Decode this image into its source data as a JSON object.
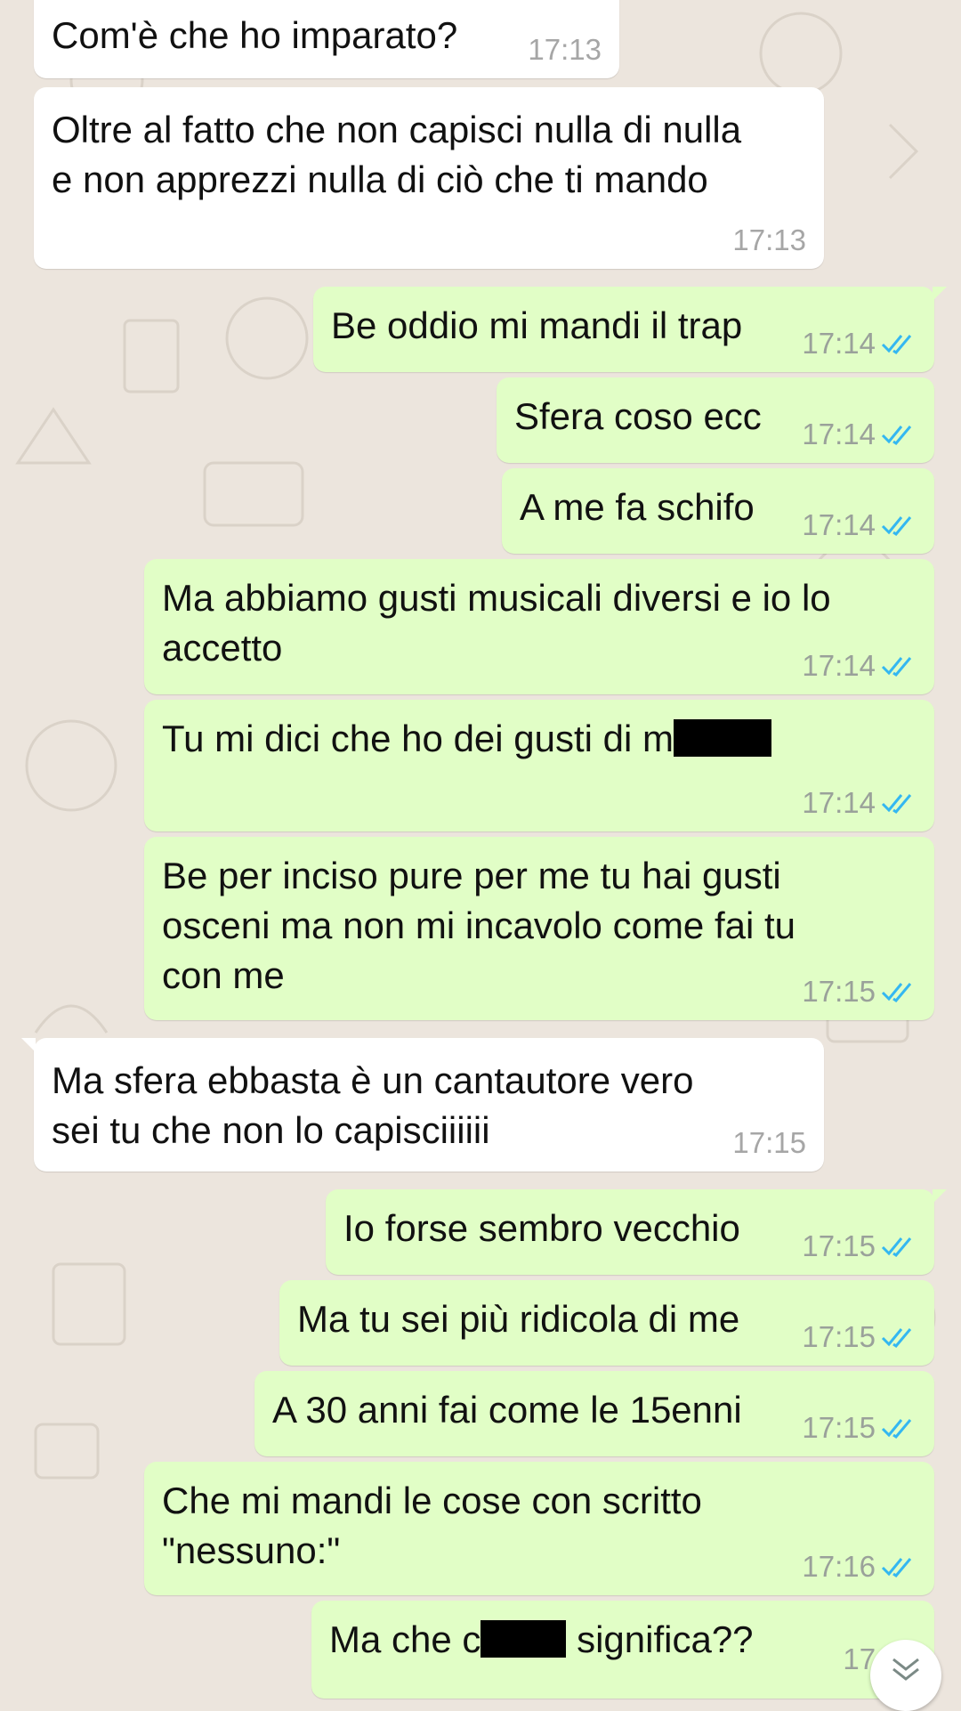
{
  "messages": [
    {
      "dir": "in",
      "text": "Com'è che ho imparato?",
      "time": "17:13"
    },
    {
      "dir": "in",
      "text": "Oltre al fatto che non capisci nulla di nulla\ne non apprezzi nulla di ciò che ti mando",
      "time": "17:13"
    },
    {
      "dir": "out",
      "text": "Be oddio mi mandi il trap",
      "time": "17:14"
    },
    {
      "dir": "out",
      "text": "Sfera coso ecc",
      "time": "17:14"
    },
    {
      "dir": "out",
      "text": "A me fa schifo",
      "time": "17:14"
    },
    {
      "dir": "out",
      "text": "Ma abbiamo gusti musicali diversi e io lo\naccetto",
      "time": "17:14"
    },
    {
      "dir": "out",
      "text_before_redaction": "Tu mi dici che ho dei gusti di m",
      "time": "17:14"
    },
    {
      "dir": "out",
      "text": "Be per inciso pure per me tu hai gusti\nosceni ma non mi incavolo come fai tu\ncon me",
      "time": "17:15"
    },
    {
      "dir": "in",
      "text": "Ma sfera ebbasta è un cantautore vero\nsei tu che non lo capisciiiiii",
      "time": "17:15"
    },
    {
      "dir": "out",
      "text": "Io forse sembro vecchio",
      "time": "17:15"
    },
    {
      "dir": "out",
      "text": "Ma tu sei più ridicola di me",
      "time": "17:15"
    },
    {
      "dir": "out",
      "text": "A 30 anni fai come le 15enni",
      "time": "17:15"
    },
    {
      "dir": "out",
      "text": "Che mi mandi le cose con scritto\n\"nessuno:\"",
      "time": "17:16"
    },
    {
      "dir": "out",
      "text_before_redaction": "Ma che c",
      "text_after_redaction": " significa??",
      "time": "17:16"
    }
  ],
  "icons": {
    "read_receipt": "double-check-icon",
    "read_receipt_color": "#34b7f1",
    "scroll_down": "chevron-double-down-icon"
  },
  "colors": {
    "background": "#ece5dd",
    "incoming_bubble": "#ffffff",
    "outgoing_bubble": "#e1fec6"
  }
}
